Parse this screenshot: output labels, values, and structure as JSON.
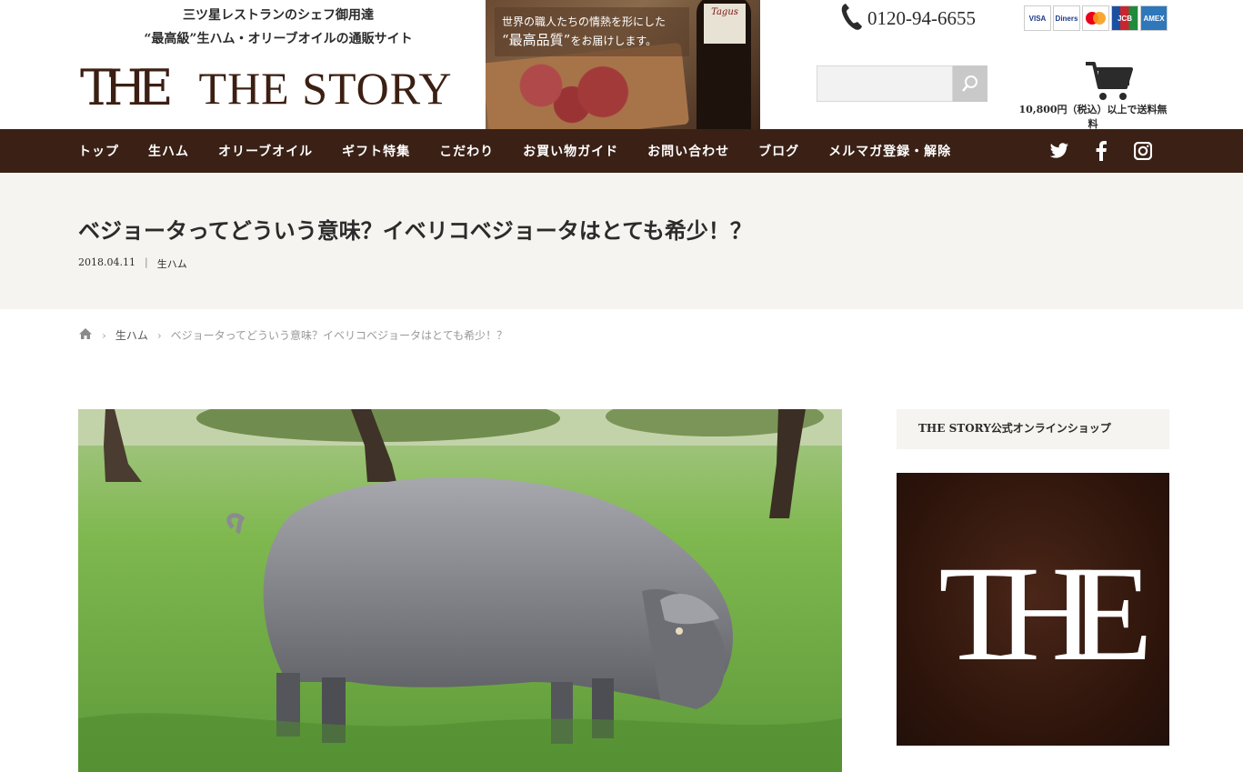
{
  "header": {
    "tagline_1": "三ツ星レストランのシェフ御用達",
    "tagline_2": "“最高級”生ハム・オリーブオイルの通販サイト",
    "logo_mark": "THE",
    "logo_text": "THE STORY",
    "banner": {
      "line_1": "世界の職人たちの情熱を形にした",
      "line_2_big": "“最高品質”",
      "line_2_rest": "をお届けします。",
      "bottle_label": "Tagus"
    },
    "phone": "0120-94-6655",
    "cards": [
      "VISA",
      "Diners",
      "MasterCard",
      "JCB",
      "AMEX"
    ],
    "search": {
      "placeholder": ""
    },
    "shipping_note": "10,800円（税込）以上で送料無料"
  },
  "nav": {
    "items": [
      "トップ",
      "生ハム",
      "オリーブオイル",
      "ギフト特集",
      "こだわり",
      "お買い物ガイド",
      "お問い合わせ",
      "ブログ",
      "メルマガ登録・解除"
    ],
    "social": [
      "twitter-icon",
      "facebook-icon",
      "instagram-icon"
    ]
  },
  "article": {
    "title": "ベジョータってどういう意味？イベリコベジョータはとても希少！？",
    "date": "2018.04.11",
    "separator": "|",
    "category": "生ハム"
  },
  "breadcrumb": {
    "category": "生ハム",
    "current": "ベジョータってどういう意味？イベリコベジョータはとても希少！？"
  },
  "sidebar": {
    "heading": "THE STORY公式オンラインショップ",
    "banner_logo": "THE"
  },
  "colors": {
    "brand_brown": "#3a2015",
    "band_bg": "#f5f4f0"
  }
}
